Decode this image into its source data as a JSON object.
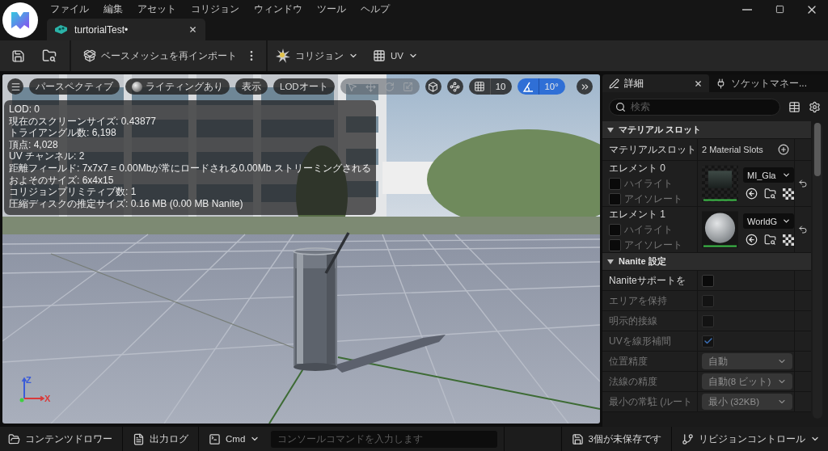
{
  "menu_bar": {
    "items": [
      "ファイル",
      "編集",
      "アセット",
      "コリジョン",
      "ウィンドウ",
      "ツール",
      "ヘルプ"
    ]
  },
  "document_tabs": [
    {
      "label": "turtorialTest•",
      "selected": true
    }
  ],
  "toolbar": {
    "reimport": "ベースメッシュを再インポート",
    "collision": "コリジョン",
    "uv": "UV"
  },
  "viewport": {
    "buttons": [
      {
        "kind": "view_mode",
        "label": "パースペクティブ"
      },
      {
        "kind": "lighting",
        "label": "ライティングあり"
      },
      {
        "kind": "show",
        "label": "表示"
      },
      {
        "kind": "lod",
        "label": "LODオート"
      }
    ],
    "snaps": [
      {
        "kind": "grid",
        "value": "10",
        "on": false
      },
      {
        "kind": "angle",
        "value": "10°",
        "on": true
      }
    ],
    "stats": [
      "LOD: 0",
      "現在のスクリーンサイズ: 0.43877",
      "トライアングル数: 6,198",
      "頂点: 4,028",
      "UV チャンネル: 2",
      "距離フィールド: 7x7x7 = 0.00Mbが常にロードされる0.00Mb ストリーミングされる",
      "およそのサイズ: 6x4x15",
      "コリジョンプリミティブ数: 1",
      "圧縮ディスクの推定サイズ: 0.16 MB (0.00 MB Nanite)"
    ],
    "axes": [
      {
        "kind": "up",
        "label": "Z",
        "color": "#3a5bd9"
      },
      {
        "kind": "right",
        "label": "X",
        "color": "#d93a3a"
      }
    ]
  },
  "details_panel": {
    "tabs": [
      {
        "kind": "details",
        "label": "詳細",
        "selected": true,
        "closable": true
      },
      {
        "kind": "sockets",
        "label": "ソケットマネー...",
        "selected": false,
        "closable": false
      }
    ],
    "search": {
      "placeholder": "検索"
    },
    "sections": [
      {
        "title": "マテリアル スロット",
        "expanded": true,
        "rows": [
          {
            "kind": "value",
            "label": "マテリアルスロット",
            "value": "2 Material Slots"
          },
          {
            "kind": "material",
            "label": "エレメント 0",
            "options": [
              {
                "label": "ハイライト",
                "checked": false
              },
              {
                "label": "アイソレート",
                "checked": false
              }
            ],
            "material": "MI_Gla",
            "preview": {
              "kind": "glass"
            }
          },
          {
            "kind": "material",
            "label": "エレメント 1",
            "options": [
              {
                "label": "ハイライト",
                "checked": false
              },
              {
                "label": "アイソレート",
                "checked": false
              }
            ],
            "material": "WorldG",
            "preview": {
              "kind": "sphere"
            }
          }
        ]
      },
      {
        "title": "Nanite 設定",
        "expanded": true,
        "rows": [
          {
            "kind": "checkbox",
            "label": "Naniteサポートを",
            "checked": false,
            "disabled": false
          },
          {
            "kind": "checkbox",
            "label": "エリアを保持",
            "checked": false,
            "disabled": true
          },
          {
            "kind": "checkbox",
            "label": "明示的接線",
            "checked": false,
            "disabled": true
          },
          {
            "kind": "checkbox",
            "label": "UVを線形補間",
            "checked": true,
            "disabled": true
          },
          {
            "kind": "dropdown",
            "label": "位置精度",
            "value": "自動",
            "disabled": true
          },
          {
            "kind": "dropdown",
            "label": "法線の精度",
            "value": "自動(8 ビット)",
            "disabled": true
          },
          {
            "kind": "dropdown",
            "label": "最小の常駐 (ルート",
            "value": "最小 (32KB)",
            "disabled": true
          }
        ]
      }
    ]
  },
  "status_bar": {
    "content_drawer": "コンテンツドロワー",
    "output_log": "出力ログ",
    "cmd": "Cmd",
    "console": {
      "placeholder": "コンソールコマンドを入力します"
    },
    "unsaved": "3個が未保存です",
    "revision_control": "リビジョンコントロール"
  }
}
